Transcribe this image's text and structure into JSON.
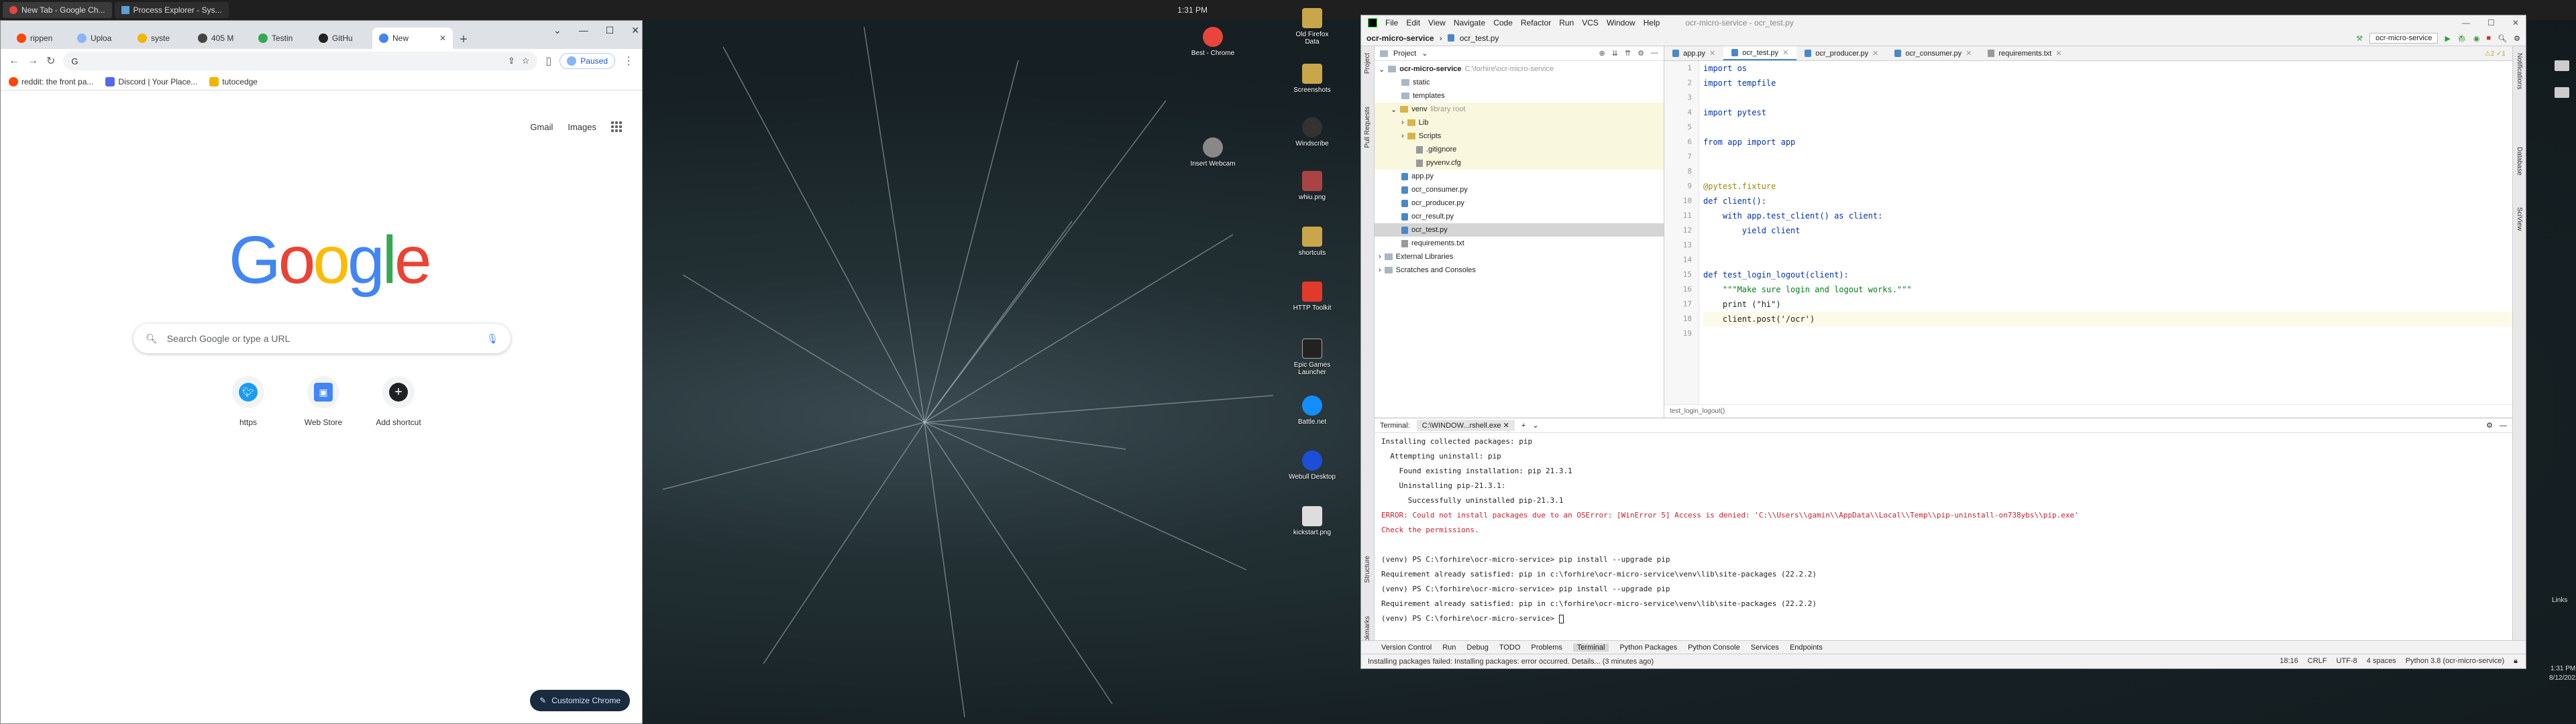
{
  "taskbar": {
    "items": [
      {
        "label": "New Tab - Google Ch...",
        "active": true
      },
      {
        "label": "Process Explorer - Sys...",
        "active": false
      }
    ],
    "time": "1:31 PM"
  },
  "chrome": {
    "tabs": [
      {
        "label": "rippen"
      },
      {
        "label": "Uploa"
      },
      {
        "label": "syste"
      },
      {
        "label": "405 M"
      },
      {
        "label": "Testin"
      },
      {
        "label": "GitHu"
      },
      {
        "label": "New",
        "active": true
      }
    ],
    "new_tab_symbol": "+",
    "omnibox_value": "G",
    "profile_status": "Paused",
    "bookmarks": [
      {
        "label": "reddit: the front pa...",
        "color": "#ff4500"
      },
      {
        "label": "Discord | Your Place...",
        "color": "#5865f2"
      },
      {
        "label": "tutocedge",
        "color": "#f4b400"
      }
    ],
    "gmail": "Gmail",
    "images": "Images",
    "search_placeholder": "Search Google or type a URL",
    "shortcuts": [
      {
        "label": "https",
        "icon": "twitter-icon",
        "color": "#1d9bf0"
      },
      {
        "label": "Web Store",
        "icon": "webstore-icon",
        "color": "#4285f4"
      },
      {
        "label": "Add shortcut",
        "icon": "plus-icon",
        "color": "#202124"
      }
    ],
    "customize_label": "Customize Chrome"
  },
  "desktop_icons": [
    {
      "label": "Best - Chrome",
      "color": "#e8453c"
    },
    {
      "label": "Insert Webcam",
      "color": "#888888"
    },
    {
      "label": "Old Firefox Data",
      "color": "#c9a64a"
    },
    {
      "label": "Screenshots",
      "color": "#c9a64a"
    },
    {
      "label": "Windscribe",
      "color": "#333333"
    },
    {
      "label": "whiu.png",
      "color": "#aa4444"
    },
    {
      "label": "shortcuts",
      "color": "#c9a64a"
    },
    {
      "label": "HTTP Toolkit",
      "color": "#e13a2b"
    },
    {
      "label": "Epic Games Launcher",
      "color": "#222222"
    },
    {
      "label": "Battle.net",
      "color": "#148eff"
    },
    {
      "label": "Webull Desktop",
      "color": "#1b4fd8"
    },
    {
      "label": "kickstart.png",
      "color": "#dddddd"
    }
  ],
  "pycharm": {
    "menu": [
      "File",
      "Edit",
      "View",
      "Navigate",
      "Code",
      "Refactor",
      "Run",
      "VCS",
      "Window",
      "Help"
    ],
    "title": "ocr-micro-service - ocr_test.py",
    "breadcrumb": [
      "ocr-micro-service",
      "ocr_test.py"
    ],
    "run_config": "ocr-micro-service",
    "left_strip": [
      "Project",
      "Pull Requests",
      "Structure",
      "Bookmarks"
    ],
    "right_strip": [
      "Notifications",
      "Database",
      "SciView"
    ],
    "project_header": "Project",
    "tree": [
      {
        "label": "ocr-micro-service",
        "extra": "C:\\forhire\\ocr-micro-service",
        "indent": 0,
        "type": "folder",
        "bold": true
      },
      {
        "label": "static",
        "indent": 2,
        "type": "folder"
      },
      {
        "label": "templates",
        "indent": 2,
        "type": "folder"
      },
      {
        "label": "venv",
        "extra": "library root",
        "indent": 1,
        "type": "folder",
        "venv": true
      },
      {
        "label": "Lib",
        "indent": 3,
        "type": "folder",
        "venv": true
      },
      {
        "label": "Scripts",
        "indent": 3,
        "type": "folder",
        "venv": true
      },
      {
        "label": ".gitignore",
        "indent": 4,
        "type": "txt",
        "venv": true
      },
      {
        "label": "pyvenv.cfg",
        "indent": 4,
        "type": "txt",
        "venv": true
      },
      {
        "label": "app.py",
        "indent": 2,
        "type": "py"
      },
      {
        "label": "ocr_consumer.py",
        "indent": 2,
        "type": "py"
      },
      {
        "label": "ocr_producer.py",
        "indent": 2,
        "type": "py"
      },
      {
        "label": "ocr_result.py",
        "indent": 2,
        "type": "py"
      },
      {
        "label": "ocr_test.py",
        "indent": 2,
        "type": "py",
        "selected": true
      },
      {
        "label": "requirements.txt",
        "indent": 2,
        "type": "txt"
      },
      {
        "label": "External Libraries",
        "indent": 0,
        "type": "folder"
      },
      {
        "label": "Scratches and Consoles",
        "indent": 0,
        "type": "folder"
      }
    ],
    "editor_tabs": [
      {
        "label": "app.py"
      },
      {
        "label": "ocr_test.py",
        "active": true
      },
      {
        "label": "ocr_producer.py"
      },
      {
        "label": "ocr_consumer.py"
      },
      {
        "label": "requirements.txt"
      }
    ],
    "inspections": "⚠2  ✓1",
    "code_lines": [
      "import os",
      "import tempfile",
      "",
      "import pytest",
      "",
      "from app import app",
      "",
      "",
      "@pytest.fixture",
      "def client():",
      "    with app.test_client() as client:",
      "        yield client",
      "",
      "",
      "def test_login_logout(client):",
      "    \"\"\"Make sure login and logout works.\"\"\"",
      "    print (\"hi\")",
      "    client.post('/ocr')",
      ""
    ],
    "editor_breadcrumb": "test_login_logout()",
    "terminal_title": "Terminal:",
    "terminal_tab": "C:\\WINDOW...rshell.exe",
    "terminal_lines": [
      {
        "text": "Installing collected packages: pip",
        "style": ""
      },
      {
        "text": "  Attempting uninstall: pip",
        "style": ""
      },
      {
        "text": "    Found existing installation: pip 21.3.1",
        "style": ""
      },
      {
        "text": "    Uninstalling pip-21.3.1:",
        "style": ""
      },
      {
        "text": "      Successfully uninstalled pip-21.3.1",
        "style": ""
      },
      {
        "text": "ERROR: Could not install packages due to an OSError: [WinError 5] Access is denied: 'C:\\\\Users\\\\gamin\\\\AppData\\\\Local\\\\Temp\\\\pip-uninstall-on738ybs\\\\pip.exe'",
        "style": "err"
      },
      {
        "text": "Check the permissions.",
        "style": "err"
      },
      {
        "text": "",
        "style": ""
      },
      {
        "text": "(venv) PS C:\\forhire\\ocr-micro-service> pip install --upgrade pip",
        "style": ""
      },
      {
        "text": "Requirement already satisfied: pip in c:\\forhire\\ocr-micro-service\\venv\\lib\\site-packages (22.2.2)",
        "style": ""
      },
      {
        "text": "(venv) PS C:\\forhire\\ocr-micro-service> pip install --upgrade pip",
        "style": ""
      },
      {
        "text": "Requirement already satisfied: pip in c:\\forhire\\ocr-micro-service\\venv\\lib\\site-packages (22.2.2)",
        "style": ""
      },
      {
        "text": "(venv) PS C:\\forhire\\ocr-micro-service> ",
        "style": "prompt"
      }
    ],
    "bottom_tools": [
      "Version Control",
      "Run",
      "Debug",
      "TODO",
      "Problems",
      "Terminal",
      "Python Packages",
      "Python Console",
      "Services",
      "Endpoints"
    ],
    "status_message": "Installing packages failed: Installing packages: error occurred. Details... (3 minutes ago)",
    "status_right": [
      "18:16",
      "CRLF",
      "UTF-8",
      "4 spaces",
      "Python 3.8 (ocr-micro-service)"
    ]
  },
  "system_tray": {
    "links": "Links",
    "time": "1:31 PM",
    "date": "8/12/2022"
  }
}
